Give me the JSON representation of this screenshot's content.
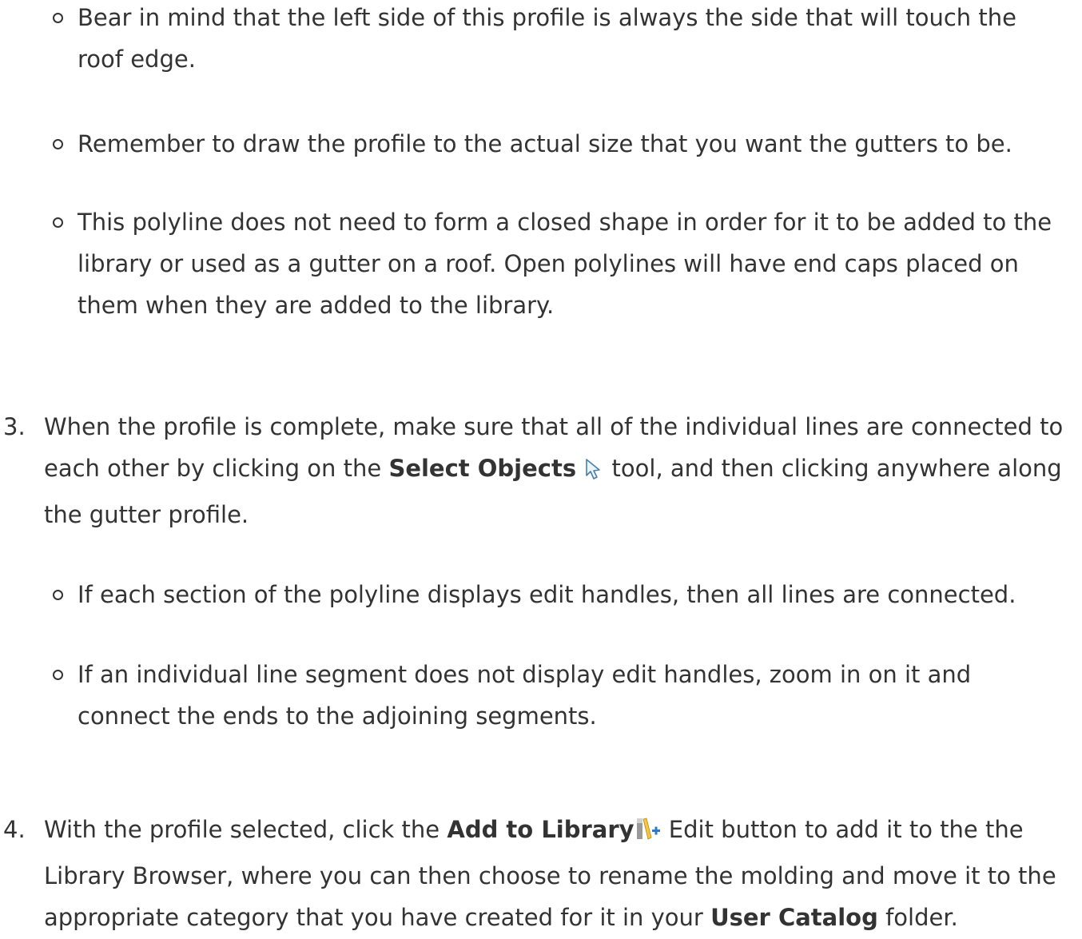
{
  "step2_bullets": [
    "Bear in mind that the left side of this profile is always the side that will touch the roof edge.",
    "Remember to draw the profile to the actual size that you want the gutters to be.",
    "This polyline does not need to form a closed shape in order for it to be added to the library or used as a gutter on a roof. Open polylines will have end caps placed on them when they are added to the library."
  ],
  "step3": {
    "number": "3.",
    "text_before": "When the profile is complete, make sure that all of the individual lines are connected to each other by clicking on the ",
    "bold": "Select Objects",
    "icon": "select-objects-arrow-icon",
    "text_after": " tool, and then clicking anywhere along the gutter profile.",
    "bullets": [
      "If each section of the polyline displays edit handles, then all lines are connected.",
      "If an individual line segment does not display edit handles, zoom in on it and connect the ends to the adjoining segments."
    ]
  },
  "step4": {
    "number": "4.",
    "text_before": "With the profile selected, click the ",
    "bold": "Add to Library",
    "icon": "add-to-library-icon",
    "text_middle": " Edit button to add it to the the Library Browser, where you can then choose to rename the molding and move it to the appropriate category that you have created for it in your ",
    "bold2": "User Catalog",
    "text_after": " folder."
  }
}
